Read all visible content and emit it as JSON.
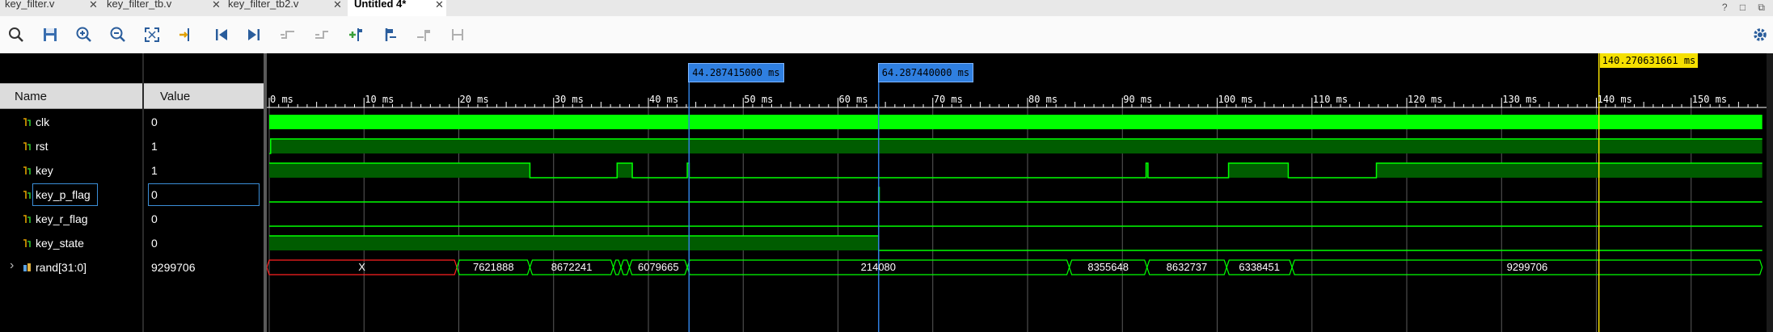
{
  "tabs": [
    {
      "label": "key_filter.v",
      "active": false
    },
    {
      "label": "key_filter_tb.v",
      "active": false
    },
    {
      "label": "key_filter_tb2.v",
      "active": false
    },
    {
      "label": "Untitled 4*",
      "active": true
    }
  ],
  "window_controls": "? □ ⧉",
  "toolbar": {
    "icons": [
      "search-icon",
      "save-icon",
      "zoom-in-icon",
      "zoom-out-icon",
      "zoom-fit-icon",
      "go-to-cursor-icon",
      "go-to-time-zero-icon",
      "go-to-last-time-icon",
      "previous-transition-icon",
      "next-transition-icon",
      "add-marker-icon",
      "previous-marker-icon",
      "next-marker-icon",
      "swap-cursors-icon",
      "settings-icon"
    ]
  },
  "columns": {
    "name": "Name",
    "value": "Value"
  },
  "signals": [
    {
      "name": "clk",
      "value": "0",
      "kind": "bit"
    },
    {
      "name": "rst",
      "value": "1",
      "kind": "bit"
    },
    {
      "name": "key",
      "value": "1",
      "kind": "bit"
    },
    {
      "name": "key_p_flag",
      "value": "0",
      "kind": "bit",
      "selected": true
    },
    {
      "name": "key_r_flag",
      "value": "0",
      "kind": "bit"
    },
    {
      "name": "key_state",
      "value": "0",
      "kind": "bit"
    },
    {
      "name": "rand[31:0]",
      "value": "9299706",
      "kind": "bus"
    }
  ],
  "time_axis": {
    "ticks": [
      "0 ms",
      "10 ms",
      "20 ms",
      "30 ms",
      "40 ms",
      "50 ms",
      "60 ms",
      "70 ms",
      "80 ms",
      "90 ms",
      "100 ms",
      "110 ms",
      "120 ms",
      "130 ms",
      "140 ms",
      "150 ms"
    ],
    "range_ms": [
      0,
      157.5
    ]
  },
  "cursors": [
    {
      "label": "44.287415000 ms",
      "time_ms": 44.287415
    },
    {
      "label": "64.287440000 ms",
      "time_ms": 64.28744
    }
  ],
  "marker": {
    "label": "140.270631661 ms",
    "time_ms": 140.270631661
  },
  "bus_values": [
    "X",
    "7621888",
    "8672241",
    "6079665",
    "214080",
    "8355648",
    "8632737",
    "6338451",
    "9299706"
  ],
  "colors": {
    "wave_green": "#00ff00",
    "bus_x_red": "#ff2020",
    "cursor_blue": "#2f7fe0",
    "marker_yellow": "#f5e000",
    "background": "#000000"
  }
}
